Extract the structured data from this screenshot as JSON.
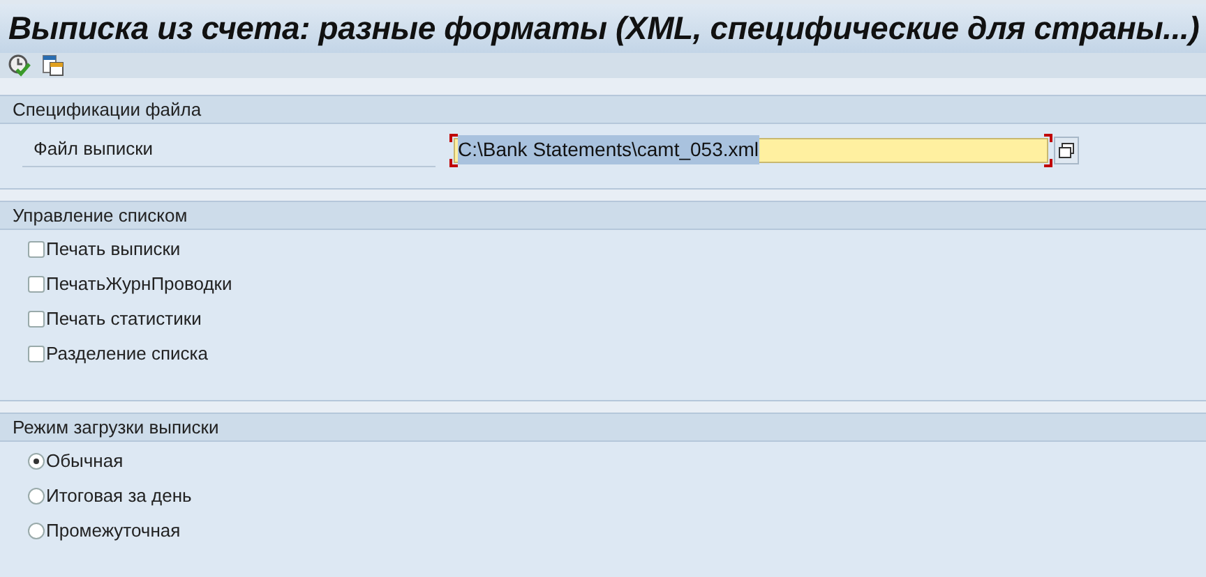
{
  "window": {
    "title": "Выписка из счета: разные форматы (XML, специфические для страны...)"
  },
  "groups": [
    {
      "title": "Спецификации файла",
      "kind": "fields",
      "fields": [
        {
          "label": "Файл выписки",
          "value": "C:\\Bank Statements\\camt_053.xml",
          "selected": true
        }
      ]
    },
    {
      "title": "Управление списком",
      "kind": "checkboxes",
      "items": [
        {
          "label": "Печать выписки",
          "checked": false
        },
        {
          "label": "ПечатьЖурнПроводки",
          "checked": false
        },
        {
          "label": "Печать статистики",
          "checked": false
        },
        {
          "label": "Разделение списка",
          "checked": false
        }
      ]
    },
    {
      "title": "Режим загрузки выписки",
      "kind": "radios",
      "items": [
        {
          "label": "Обычная",
          "selected": true
        },
        {
          "label": "Итоговая за день",
          "selected": false
        },
        {
          "label": "Промежуточная",
          "selected": false
        }
      ]
    }
  ]
}
